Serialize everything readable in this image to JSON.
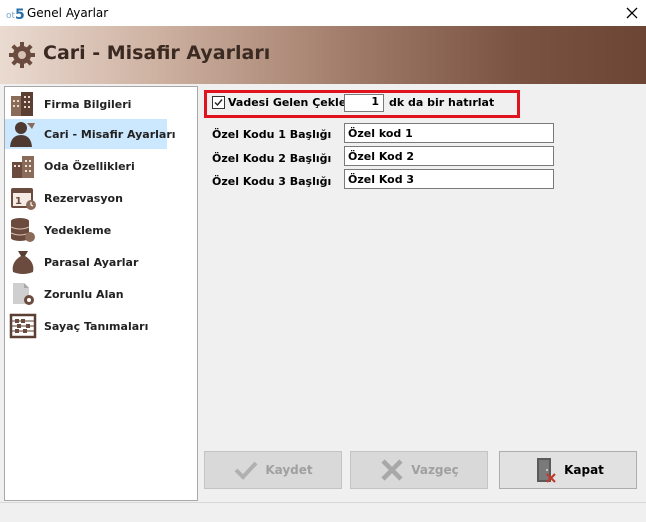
{
  "window": {
    "title": "Genel Ayarlar",
    "icon": "app-icon",
    "close": "×"
  },
  "header": {
    "title": "Cari - Misafir Ayarları",
    "icon": "gear-icon"
  },
  "sidebar": {
    "items": [
      {
        "label": "Firma Bilgileri",
        "icon": "building-icon",
        "active": false
      },
      {
        "label": "Cari - Misafir Ayarları",
        "icon": "guest-icon",
        "active": true
      },
      {
        "label": "Oda Özellikleri",
        "icon": "rooms-icon",
        "active": false
      },
      {
        "label": "Rezervasyon",
        "icon": "calendar-icon",
        "active": false
      },
      {
        "label": "Yedekleme",
        "icon": "database-icon",
        "active": false
      },
      {
        "label": "Parasal Ayarlar",
        "icon": "money-bag-icon",
        "active": false
      },
      {
        "label": "Zorunlu Alan",
        "icon": "document-gear-icon",
        "active": false
      },
      {
        "label": "Sayaç Tanımaları",
        "icon": "abacus-icon",
        "active": false
      }
    ]
  },
  "main": {
    "reminder": {
      "checked": true,
      "label": "Vadesi Gelen Çekleri",
      "value": "1",
      "suffix": "dk da bir hatırlat"
    },
    "fields": [
      {
        "label": "Özel Kodu 1 Başlığı",
        "value": "Özel kod 1"
      },
      {
        "label": "Özel Kodu 2 Başlığı",
        "value": "Özel Kod 2"
      },
      {
        "label": "Özel Kodu 3 Başlığı",
        "value": "Özel Kod 3"
      }
    ]
  },
  "buttons": {
    "save": {
      "label": "Kaydet",
      "enabled": false
    },
    "cancel": {
      "label": "Vazgeç",
      "enabled": false
    },
    "close": {
      "label": "Kapat",
      "enabled": true
    }
  },
  "colors": {
    "highlight": "#e0141e",
    "banner_dark": "#6d4534",
    "banner_light": "#eadbd1",
    "active_item": "#cce8ff"
  }
}
